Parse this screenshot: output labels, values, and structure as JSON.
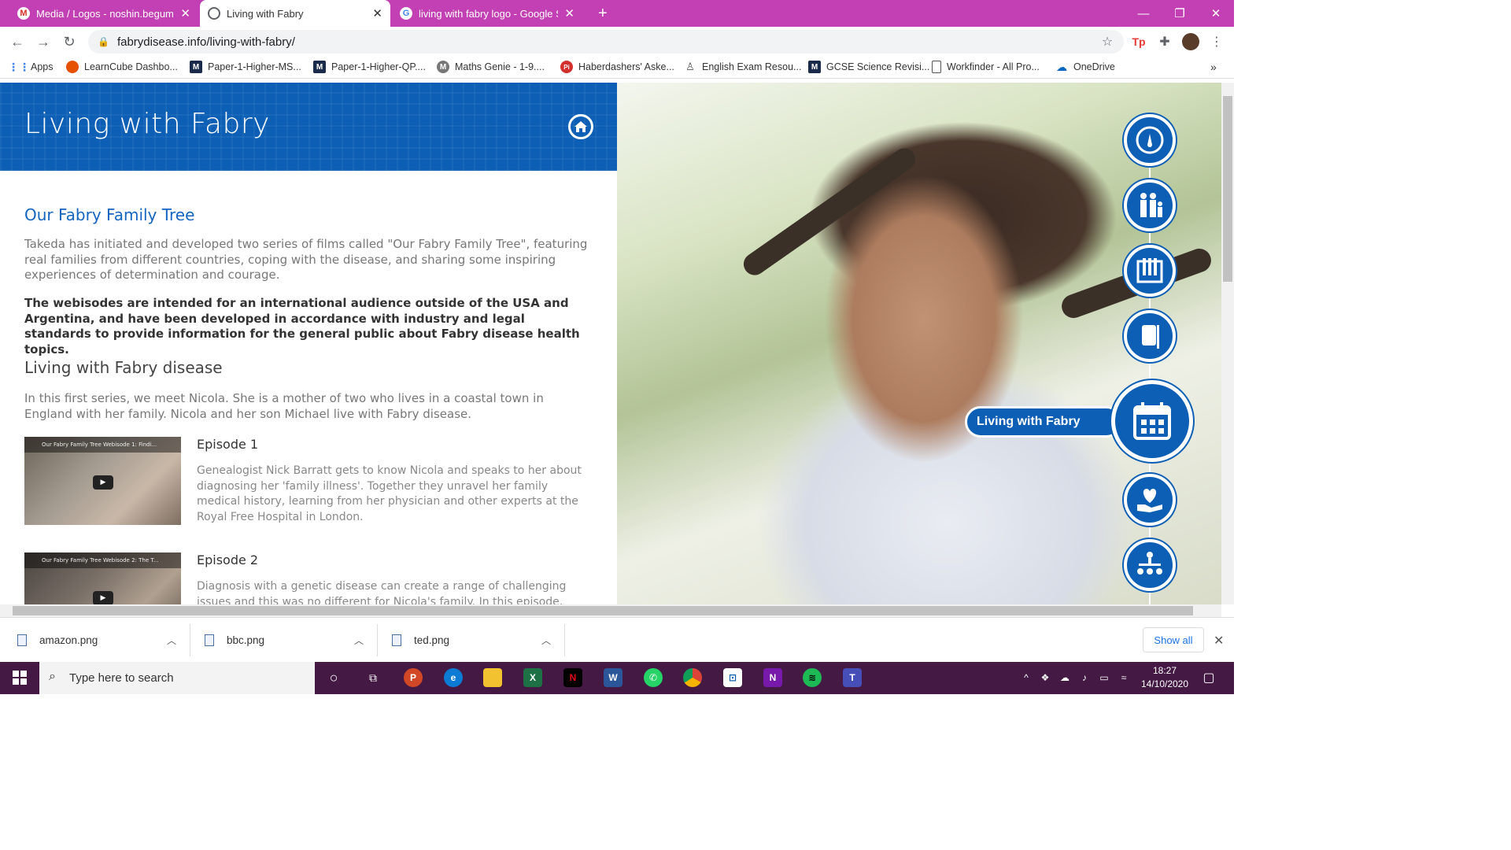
{
  "browser": {
    "tabs": [
      {
        "title": "Media / Logos - noshin.begum.n",
        "favicon": "gmail-icon",
        "active": false
      },
      {
        "title": "Living with Fabry",
        "favicon": "globe-icon",
        "active": true
      },
      {
        "title": "living with fabry logo - Google S",
        "favicon": "google-icon",
        "active": false
      }
    ],
    "url": "fabrydisease.info/living-with-fabry/",
    "bookmarks": [
      {
        "label": "Apps",
        "icon": "apps-grid-icon"
      },
      {
        "label": "LearnCube Dashbo...",
        "icon": "learncube-icon"
      },
      {
        "label": "Paper-1-Higher-MS...",
        "icon": "m-icon"
      },
      {
        "label": "Paper-1-Higher-QP....",
        "icon": "m-icon"
      },
      {
        "label": "Maths Genie - 1-9....",
        "icon": "mathsgenie-icon"
      },
      {
        "label": "Haberdashers' Aske...",
        "icon": "pi-icon"
      },
      {
        "label": "English Exam Resou...",
        "icon": "english-icon"
      },
      {
        "label": "GCSE Science Revisi...",
        "icon": "m-icon"
      },
      {
        "label": "Workfinder - All Pro...",
        "icon": "page-icon"
      },
      {
        "label": "OneDrive",
        "icon": "onedrive-icon"
      }
    ]
  },
  "page": {
    "header_title": "Living with Fabry",
    "section1_title": "Our Fabry Family Tree",
    "intro": "Takeda has initiated and developed two series of films called \"Our Fabry Family Tree\", featuring real families from different countries, coping with the disease, and sharing some inspiring experiences of determination and courage.",
    "notice": "The webisodes are intended for an international audience outside of the USA and Argentina, and have been developed in accordance with industry and legal standards to provide information for the general public about Fabry disease health topics.",
    "section2_title": "Living with Fabry disease",
    "series_intro": "In this first series, we meet Nicola. She is a mother of two who lives in a coastal town in England with her family. Nicola and her son Michael live with Fabry disease.",
    "episodes": [
      {
        "title": "Episode 1",
        "thumb_caption": "Our Fabry Family Tree Webisode 1: Findi...",
        "description": "Genealogist Nick Barratt gets to know Nicola and speaks to her about diagnosing her 'family illness'. Together they unravel her family medical history, learning from her physician and other experts at the Royal Free Hospital in London."
      },
      {
        "title": "Episode 2",
        "thumb_caption": "Our Fabry Family Tree Webisode 2: The T...",
        "description": "Diagnosis with a genetic disease can create a range of challenging issues and this was no different for Nicola's family. In this episode, they explore their"
      }
    ],
    "side_nav": {
      "active_label": "Living with Fabry",
      "items": [
        "gauge-icon",
        "family-icon",
        "test-tubes-icon",
        "infusion-icon",
        "calendar-icon",
        "heart-hand-icon",
        "family-tree-icon"
      ]
    }
  },
  "downloads": {
    "files": [
      "amazon.png",
      "bbc.png",
      "ted.png"
    ],
    "show_all": "Show all"
  },
  "taskbar": {
    "search_placeholder": "Type here to search",
    "time": "18:27",
    "date": "14/10/2020"
  },
  "colors": {
    "tab_strip": "#c23fb4",
    "brand_blue": "#0d5fb5",
    "taskbar": "#441a44"
  }
}
